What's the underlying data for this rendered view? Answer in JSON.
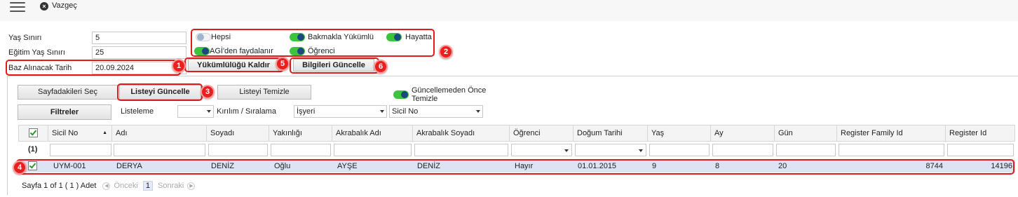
{
  "topbar": {
    "cancel_label": "Vazgeç"
  },
  "form": {
    "age_limit_label": "Yaş Sınırı",
    "age_limit_value": "5",
    "edu_age_limit_label": "Eğitim Yaş Sınırı",
    "edu_age_limit_value": "25",
    "base_date_label": "Baz Alınacak Tarih",
    "base_date_value": "20.09.2024"
  },
  "toggles": {
    "hepsi": {
      "label": "Hepsi",
      "on": false
    },
    "bakmakla": {
      "label": "Bakmakla Yükümlü",
      "on": true
    },
    "hayatta": {
      "label": "Hayatta",
      "on": true
    },
    "agi": {
      "label": "AGİ'den faydalanır",
      "on": true
    },
    "ogrenci": {
      "label": "Öğrenci",
      "on": true
    }
  },
  "actions": {
    "remove_obligation": "Yükümlülüğü Kaldır",
    "update_info": "Bilgileri Güncelle"
  },
  "panel": {
    "select_page": "Sayfadakileri Seç",
    "update_list": "Listeyi Güncelle",
    "clear_list": "Listeyi Temizle",
    "clear_before_update": "Güncellemeden Önce Temizle",
    "filters": "Filtreler",
    "listing_label": "Listeleme",
    "listing_value": "",
    "breakdown_label": "Kırılım / Sıralama",
    "breakdown_value": "İşyeri",
    "sort_value": "Sicil No"
  },
  "grid": {
    "columns": [
      "Sicil No",
      "Adı",
      "Soyadı",
      "Yakınlığı",
      "Akrabalık Adı",
      "Akrabalık Soyadı",
      "Öğrenci",
      "Doğum Tarihi",
      "Yaş",
      "Ay",
      "Gün",
      "Register Family Id",
      "Register Id"
    ],
    "filter_count": "(1)",
    "rows": [
      {
        "sicil": "UYM-001",
        "adi": "DERYA",
        "soyadi": "DENİZ",
        "yakinligi": "Oğlu",
        "akr_adi": "AYŞE",
        "akr_soyadi": "DENİZ",
        "ogrenci": "Hayır",
        "dogum": "01.01.2015",
        "yas": "9",
        "ay": "8",
        "gun": "20",
        "family_id": "8744",
        "register_id": "14196"
      }
    ]
  },
  "pager": {
    "text": "Sayfa 1 of 1 ( 1 ) Adet",
    "prev": "Önceki",
    "current": "1",
    "next": "Sonraki"
  },
  "badges": [
    "1",
    "2",
    "3",
    "4",
    "5",
    "6"
  ],
  "colors": {
    "highlight": "#e01b1b",
    "toggle_on": "#3cc43c",
    "row_selected": "#dde3f2"
  }
}
